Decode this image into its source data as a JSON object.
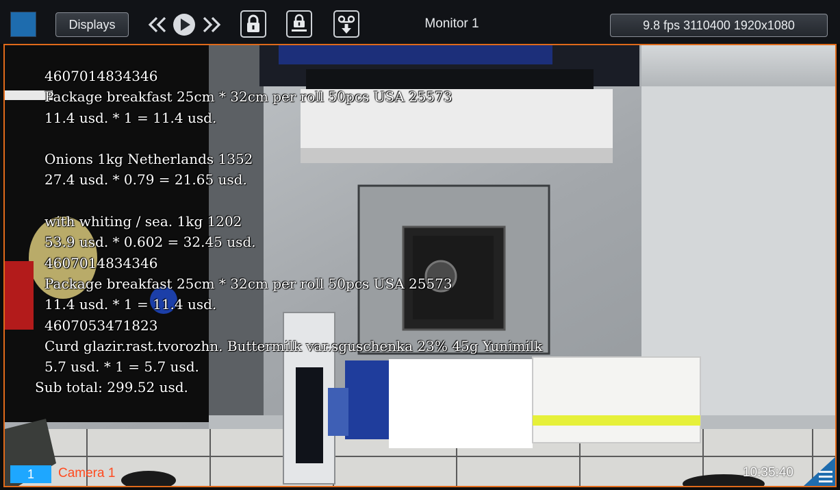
{
  "toolbar": {
    "layout_square": "layout-square-icon",
    "displays_label": "Displays",
    "playback": [
      "rewind-icon",
      "play-icon",
      "fast-forward-icon"
    ],
    "lock_icon": "lock-icon",
    "lock_bar_icon": "lock-with-bar-icon",
    "archive_icon": "tape-download-icon",
    "monitor_title": "Monitor 1",
    "stream_info": "9.8 fps 3110400 1920x1080"
  },
  "video": {
    "receipt_lines": [
      "4607014834346",
      "Package breakfast 25cm * 32cm per roll 50pcs USA 25573",
      "11.4 usd. * 1 = 11.4 usd.",
      "",
      "Onions 1kg Netherlands 1352",
      "27.4 usd. * 0.79 = 21.65 usd.",
      "",
      "with whiting / sea. 1kg 1202",
      "53.9 usd. * 0.602 = 32.45 usd.",
      "4607014834346",
      "Package breakfast 25cm * 32cm per roll 50pcs USA 25573",
      "11.4 usd. * 1 = 11.4 usd.",
      "4607053471823",
      "Curd glazir.rast.tvorozhn. Buttermilk var.sguschenka 23% 45g Yunimilk",
      "5.7 usd. * 1 = 5.7 usd.",
      "Sub total: 299.52 usd."
    ],
    "camera_number": "1",
    "camera_name": "Camera 1",
    "timecode": "10:35:40",
    "menu_icon": "hamburger-menu-icon",
    "accent_color": "#e06a1a"
  }
}
